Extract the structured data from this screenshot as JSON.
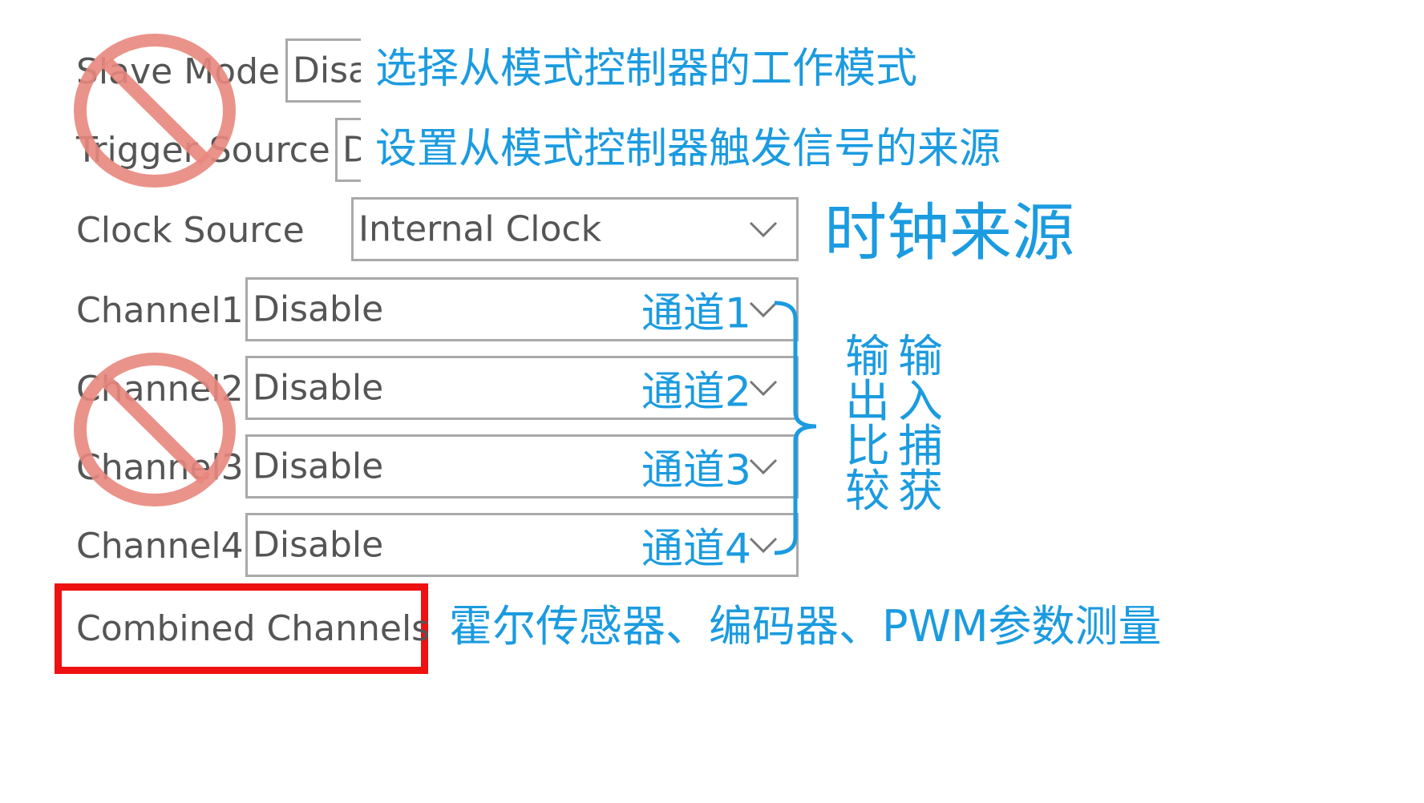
{
  "rows": {
    "slave_mode": {
      "label": "Slave Mode",
      "value": "Disable",
      "note": "选择从模式控制器的工作模式"
    },
    "trigger_source": {
      "label": "Trigger Source",
      "value": "Disable",
      "note": "设置从模式控制器触发信号的来源"
    },
    "clock_source": {
      "label": "Clock Source",
      "value": "Internal Clock",
      "note": "时钟来源"
    },
    "channel1": {
      "label": "Channel1",
      "value": "Disable",
      "note": "通道1"
    },
    "channel2": {
      "label": "Channel2",
      "value": "Disable",
      "note": "通道2"
    },
    "channel3": {
      "label": "Channel3",
      "value": "Disable",
      "note": "通道3"
    },
    "channel4": {
      "label": "Channel4",
      "value": "Disable",
      "note": "通道4"
    },
    "combined_channels": {
      "label": "Combined Channels",
      "note": "霍尔传感器、编码器、PWM参数测量"
    }
  },
  "bracket_notes": {
    "output_compare": "输出比较",
    "input_capture": "输入捕获"
  },
  "icons": {
    "prohibited": "no-sign-icon",
    "dropdown": "chevron-down-icon"
  },
  "colors": {
    "annotation": "#1b9be0",
    "prohibited": "#e8877d",
    "highlight": "#ee1111"
  }
}
